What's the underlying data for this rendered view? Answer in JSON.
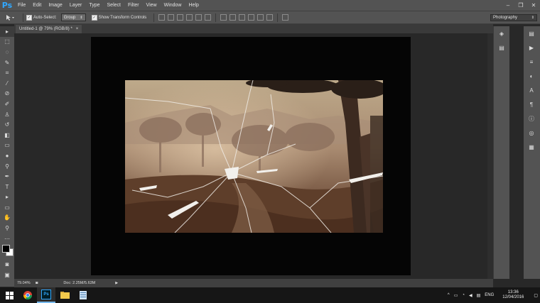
{
  "app": {
    "logo": "Ps"
  },
  "menu": [
    "File",
    "Edit",
    "Image",
    "Layer",
    "Type",
    "Select",
    "Filter",
    "View",
    "Window",
    "Help"
  ],
  "window_controls": [
    "–",
    "❐",
    "✕"
  ],
  "options": {
    "auto_select_label": "Auto-Select:",
    "auto_select_value": "Group",
    "show_transform_label": "Show Transform Controls",
    "workspace": "Photography"
  },
  "document": {
    "tab_title": "Untitled-1 @ 79% (RGB/8) *",
    "close": "×"
  },
  "status": {
    "zoom": "79.04%",
    "doc_info": "Doc: 2.25M/5.63M"
  },
  "taskbar": {
    "language": "ENG",
    "time": "13:36",
    "date": "12/04/2016"
  },
  "colors": {
    "accent": "#31a8ff",
    "chrome": "#535353",
    "workspace": "#282828"
  }
}
